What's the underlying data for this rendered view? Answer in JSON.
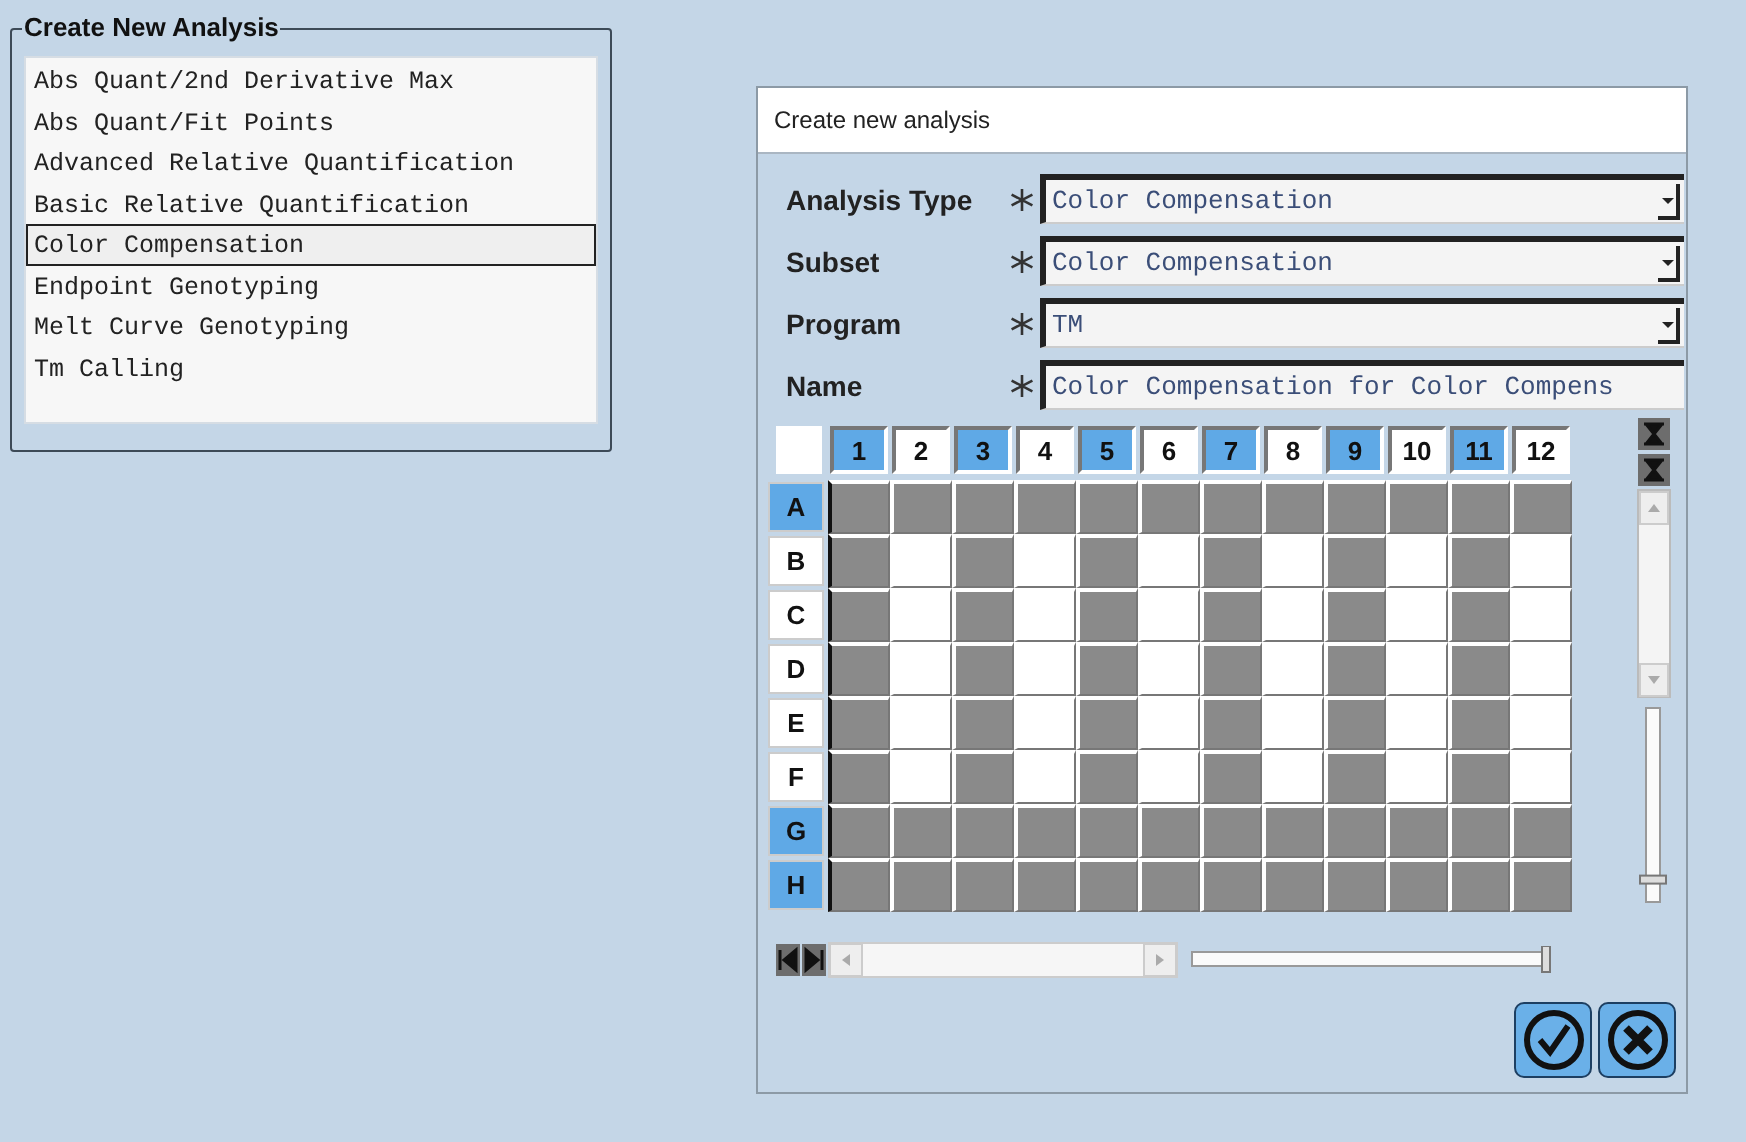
{
  "analysis_panel": {
    "title": "Create New Analysis",
    "items": [
      {
        "label": "Abs Quant/2nd Derivative Max",
        "selected": false
      },
      {
        "label": "Abs Quant/Fit Points",
        "selected": false
      },
      {
        "label": "Advanced Relative Quantification",
        "selected": false
      },
      {
        "label": "Basic Relative Quantification",
        "selected": false
      },
      {
        "label": "Color Compensation",
        "selected": true
      },
      {
        "label": "Endpoint Genotyping",
        "selected": false
      },
      {
        "label": "Melt Curve Genotyping",
        "selected": false
      },
      {
        "label": "Tm Calling",
        "selected": false
      }
    ]
  },
  "dialog": {
    "title": "Create new analysis",
    "fields": [
      {
        "label": "Analysis Type",
        "kind": "dropdown",
        "required": true,
        "value": "Color Compensation"
      },
      {
        "label": "Subset",
        "kind": "dropdown",
        "required": true,
        "value": "Color Compensation"
      },
      {
        "label": "Program",
        "kind": "dropdown",
        "required": true,
        "value": "TM"
      },
      {
        "label": "Name",
        "kind": "text",
        "required": true,
        "value": "Color Compensation for Color Compens"
      }
    ],
    "vertical_slider": {
      "level": 0.1
    },
    "horizontal_slider": {
      "level": 1
    },
    "plate": {
      "columns": [
        {
          "label": "1",
          "selected": true
        },
        {
          "label": "2",
          "selected": false
        },
        {
          "label": "3",
          "selected": true
        },
        {
          "label": "4",
          "selected": false
        },
        {
          "label": "5",
          "selected": true
        },
        {
          "label": "6",
          "selected": false
        },
        {
          "label": "7",
          "selected": true
        },
        {
          "label": "8",
          "selected": false
        },
        {
          "label": "9",
          "selected": true
        },
        {
          "label": "10",
          "selected": false
        },
        {
          "label": "11",
          "selected": true
        },
        {
          "label": "12",
          "selected": false
        }
      ],
      "rows": [
        {
          "label": "A",
          "selected": true,
          "wells": [
            true,
            true,
            true,
            true,
            true,
            true,
            true,
            true,
            true,
            true,
            true,
            true
          ]
        },
        {
          "label": "B",
          "selected": false,
          "wells": [
            true,
            false,
            true,
            false,
            true,
            false,
            true,
            false,
            true,
            false,
            true,
            false
          ]
        },
        {
          "label": "C",
          "selected": false,
          "wells": [
            true,
            false,
            true,
            false,
            true,
            false,
            true,
            false,
            true,
            false,
            true,
            false
          ]
        },
        {
          "label": "D",
          "selected": false,
          "wells": [
            true,
            false,
            true,
            false,
            true,
            false,
            true,
            false,
            true,
            false,
            true,
            false
          ]
        },
        {
          "label": "E",
          "selected": false,
          "wells": [
            true,
            false,
            true,
            false,
            true,
            false,
            true,
            false,
            true,
            false,
            true,
            false
          ]
        },
        {
          "label": "F",
          "selected": false,
          "wells": [
            true,
            false,
            true,
            false,
            true,
            false,
            true,
            false,
            true,
            false,
            true,
            false
          ]
        },
        {
          "label": "G",
          "selected": true,
          "wells": [
            true,
            true,
            true,
            true,
            true,
            true,
            true,
            true,
            true,
            true,
            true,
            true
          ]
        },
        {
          "label": "H",
          "selected": true,
          "wells": [
            true,
            true,
            true,
            true,
            true,
            true,
            true,
            true,
            true,
            true,
            true,
            true
          ]
        }
      ]
    }
  }
}
